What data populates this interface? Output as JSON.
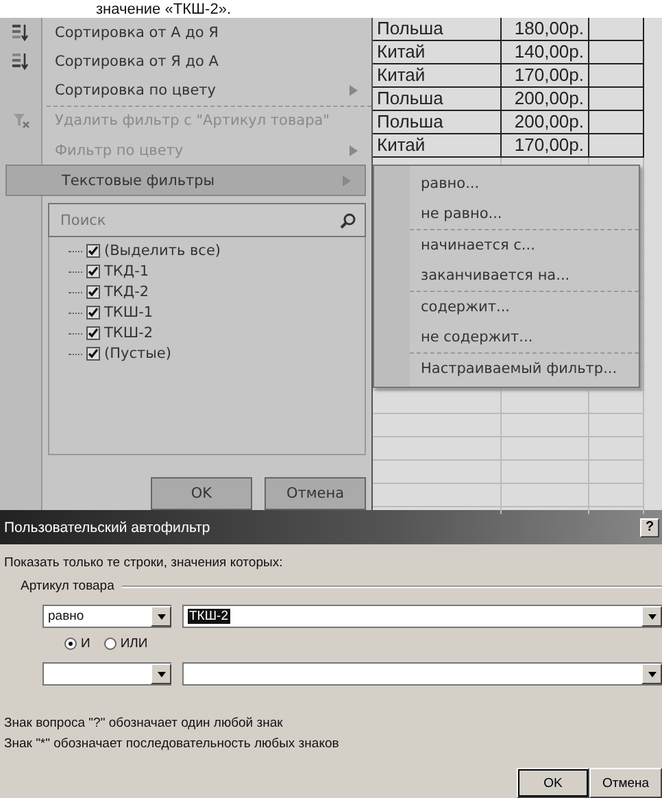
{
  "caption": "значение «ТКШ-2».",
  "filter_menu": {
    "items": [
      {
        "label": "Сортировка от А до Я",
        "disabled": false,
        "selected": false,
        "submenu": false,
        "separator_after": false
      },
      {
        "label": "Сортировка от Я до А",
        "disabled": false,
        "selected": false,
        "submenu": false,
        "separator_after": false
      },
      {
        "label": "Сортировка по цвету",
        "disabled": false,
        "selected": false,
        "submenu": true,
        "separator_after": true
      },
      {
        "label": "Удалить фильтр с \"Артикул товара\"",
        "disabled": true,
        "selected": false,
        "submenu": false,
        "separator_after": false
      },
      {
        "label": "Фильтр по цвету",
        "disabled": true,
        "selected": false,
        "submenu": true,
        "separator_after": false
      },
      {
        "label": "Текстовые фильтры",
        "disabled": false,
        "selected": true,
        "submenu": true,
        "separator_after": false
      }
    ],
    "search": {
      "placeholder": "Поиск"
    },
    "values": [
      {
        "label": "(Выделить все)",
        "checked": true
      },
      {
        "label": "ТКД-1",
        "checked": true
      },
      {
        "label": "ТКД-2",
        "checked": true
      },
      {
        "label": "ТКШ-1",
        "checked": true
      },
      {
        "label": "ТКШ-2",
        "checked": true
      },
      {
        "label": "(Пустые)",
        "checked": true
      }
    ],
    "buttons": [
      "OK",
      "Отмена"
    ]
  },
  "sheet": {
    "rows": [
      {
        "country": "Польша",
        "price": "180,00р."
      },
      {
        "country": "Китай",
        "price": "140,00р."
      },
      {
        "country": "Китай",
        "price": "170,00р."
      },
      {
        "country": "Польша",
        "price": "200,00р."
      },
      {
        "country": "Польша",
        "price": "200,00р."
      },
      {
        "country": "Китай",
        "price": "170,00р."
      }
    ]
  },
  "text_filters_menu": {
    "items": [
      {
        "label": "равно...",
        "separator_after": false
      },
      {
        "label": "не равно...",
        "separator_after": true
      },
      {
        "label": "начинается с...",
        "separator_after": false
      },
      {
        "label": "заканчивается на...",
        "separator_after": true
      },
      {
        "label": "содержит...",
        "separator_after": false
      },
      {
        "label": "не содержит...",
        "separator_after": true
      },
      {
        "label": "Настраиваемый фильтр...",
        "separator_after": false
      }
    ]
  },
  "dialog": {
    "title": "Пользовательский автофильтр",
    "help": "?",
    "prompt": "Показать только те строки, значения которых:",
    "group_label": "Артикул товара",
    "condition_1": {
      "operator": "равно",
      "value": "ТКШ-2"
    },
    "logic": [
      {
        "label": "И",
        "selected": true
      },
      {
        "label": "ИЛИ",
        "selected": false
      }
    ],
    "hints": [
      "Знак вопроса \"?\" обозначает один любой знак",
      "Знак \"*\" обозначает последовательность любых знаков"
    ],
    "buttons": [
      "OK",
      "Отмена"
    ]
  }
}
